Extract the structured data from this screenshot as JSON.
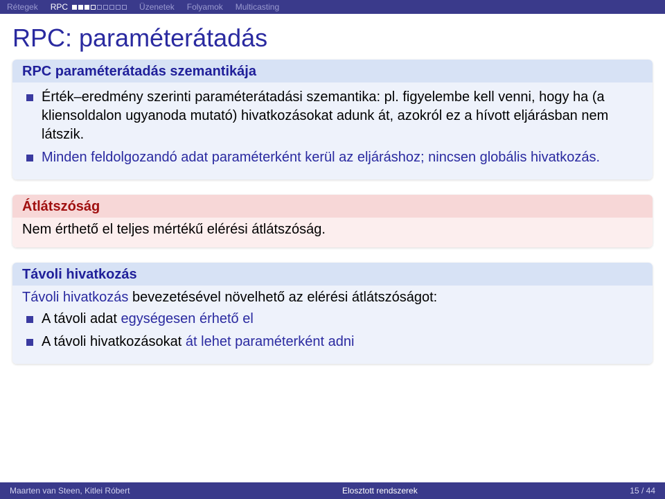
{
  "nav": {
    "items": [
      {
        "label": "Rétegek",
        "current": false
      },
      {
        "label": "RPC",
        "current": true
      },
      {
        "label": "Üzenetek",
        "current": false
      },
      {
        "label": "Folyamok",
        "current": false
      },
      {
        "label": "Multicasting",
        "current": false
      }
    ]
  },
  "title": "RPC: paraméterátadás",
  "block1": {
    "heading": "RPC paraméterátadás szemantikája",
    "item1_plain": "Érték–eredmény szerinti paraméterátadási szemantika: pl. figyelembe kell venni, hogy ha (a kliensoldalon ugyanoda mutató) hivatkozásokat adunk át, azokról ez a hívott eljárásban nem látszik.",
    "item2_a": "Minden feldolgozandó adat paraméterként kerül az eljáráshoz;",
    "item2_b": "nincsen globális hivatkozás."
  },
  "block2": {
    "heading": "Átlátszóság",
    "body": "Nem érthető el teljes mértékű elérési átlátszóság."
  },
  "block3": {
    "heading": "Távoli hivatkozás",
    "intro_a": "Távoli hivatkozás",
    "intro_b": "bevezetésével növelhető az elérési átlátszóságot:",
    "li1_a": "A távoli adat",
    "li1_b": "egységesen érhető el",
    "li2_a": "A távoli hivatkozásokat",
    "li2_b": "át lehet paraméterként adni"
  },
  "footer": {
    "authors": "Maarten van Steen, Kitlei Róbert",
    "lecture": "Elosztott rendszerek",
    "page": "15 / 44"
  }
}
